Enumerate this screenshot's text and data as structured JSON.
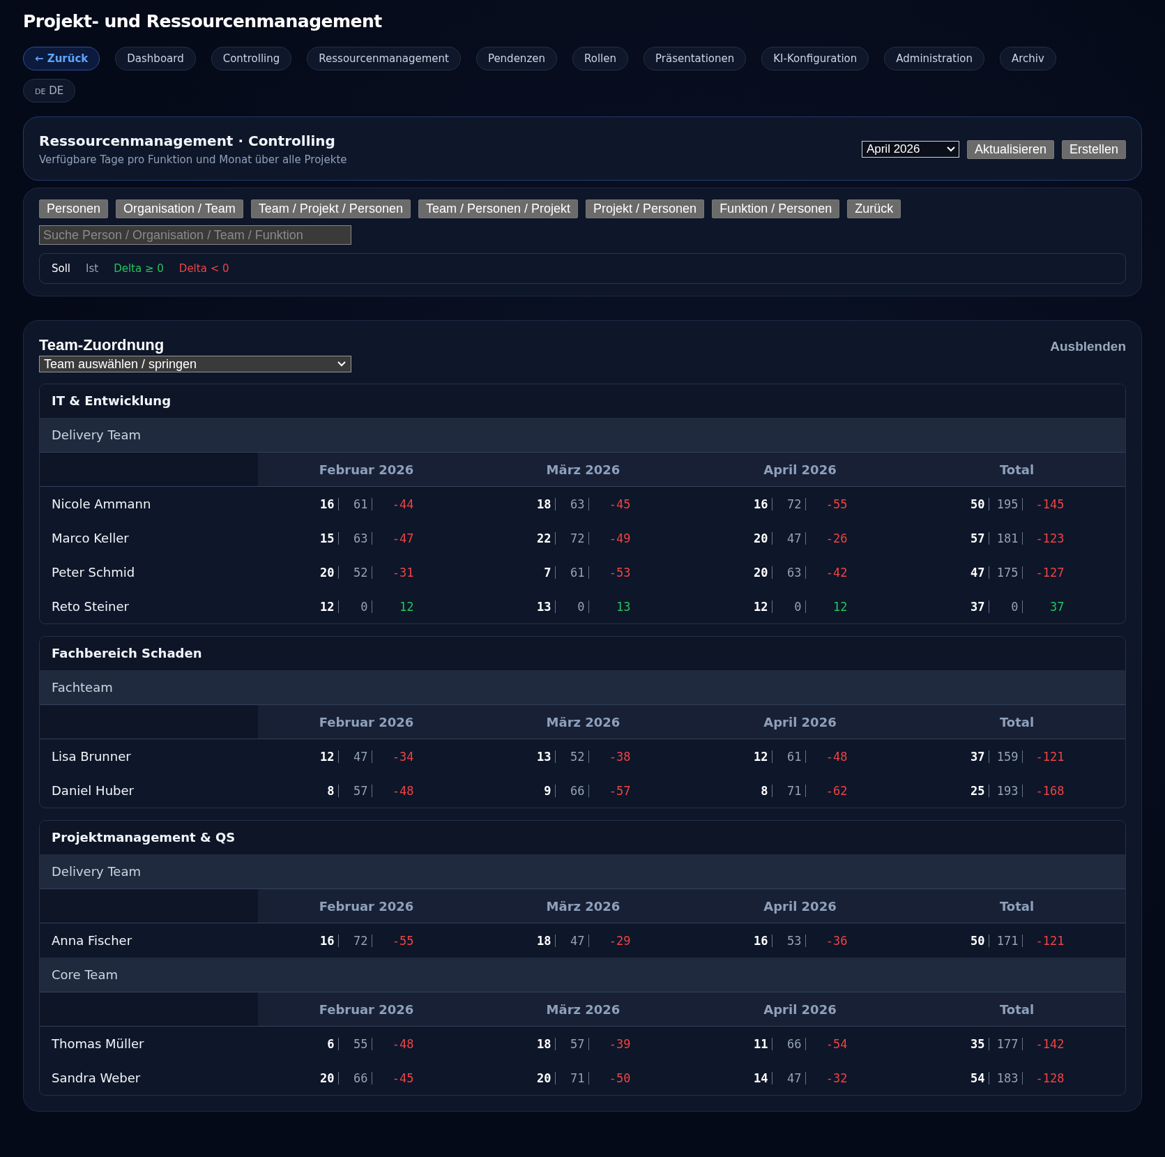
{
  "title": "Projekt- und Ressourcenmanagement",
  "nav": [
    {
      "label": "← Zurück",
      "selected": true
    },
    {
      "label": "Dashboard",
      "selected": false
    },
    {
      "label": "Controlling",
      "selected": false
    },
    {
      "label": "Ressourcenmanagement",
      "selected": false
    },
    {
      "label": "Pendenzen",
      "selected": false
    },
    {
      "label": "Rollen",
      "selected": false
    },
    {
      "label": "Präsentationen",
      "selected": false
    },
    {
      "label": "KI-Konfiguration",
      "selected": false
    },
    {
      "label": "Administration",
      "selected": false
    },
    {
      "label": "Archiv",
      "selected": false
    }
  ],
  "language": {
    "flag": "DE",
    "label": "DE"
  },
  "header": {
    "title": "Ressourcenmanagement · Controlling",
    "subtitle": "Verfügbare Tage pro Funktion und Monat über alle Projekte",
    "month_select": "April 2026",
    "buttons": [
      "Aktualisieren",
      "Erstellen"
    ]
  },
  "views": [
    "Personen",
    "Organisation / Team",
    "Team / Projekt / Personen",
    "Team / Personen / Projekt",
    "Projekt / Personen",
    "Funktion / Personen",
    "Zurück"
  ],
  "search": {
    "placeholder": "Suche Person / Organisation / Team / Funktion"
  },
  "legend": [
    {
      "label": "Soll",
      "kind": "soll"
    },
    {
      "label": "Ist",
      "kind": "ist"
    },
    {
      "label": "Delta ≥ 0",
      "kind": "pos"
    },
    {
      "label": "Delta < 0",
      "kind": "neg"
    }
  ],
  "assignment": {
    "title": "Team-Zuordnung",
    "hide": "Ausblenden",
    "team_select": "Team auswählen / springen",
    "groups": [
      {
        "name": "IT & Entwicklung",
        "teams": [
          {
            "name": "Delivery Team",
            "columns": [
              "Februar 2026",
              "März 2026",
              "April 2026",
              "Total"
            ],
            "rows": [
              {
                "name": "Nicole Ammann",
                "cells": [
                  {
                    "soll": "16",
                    "ist": "61",
                    "delta": "-44",
                    "ok": false
                  },
                  {
                    "soll": "18",
                    "ist": "63",
                    "delta": "-45",
                    "ok": false
                  },
                  {
                    "soll": "16",
                    "ist": "72",
                    "delta": "-55",
                    "ok": false
                  },
                  {
                    "soll": "50",
                    "ist": "195",
                    "delta": "-145",
                    "ok": false
                  }
                ]
              },
              {
                "name": "Marco Keller",
                "cells": [
                  {
                    "soll": "15",
                    "ist": "63",
                    "delta": "-47",
                    "ok": false
                  },
                  {
                    "soll": "22",
                    "ist": "72",
                    "delta": "-49",
                    "ok": false
                  },
                  {
                    "soll": "20",
                    "ist": "47",
                    "delta": "-26",
                    "ok": false
                  },
                  {
                    "soll": "57",
                    "ist": "181",
                    "delta": "-123",
                    "ok": false
                  }
                ]
              },
              {
                "name": "Peter Schmid",
                "cells": [
                  {
                    "soll": "20",
                    "ist": "52",
                    "delta": "-31",
                    "ok": false
                  },
                  {
                    "soll": "7",
                    "ist": "61",
                    "delta": "-53",
                    "ok": false
                  },
                  {
                    "soll": "20",
                    "ist": "63",
                    "delta": "-42",
                    "ok": false
                  },
                  {
                    "soll": "47",
                    "ist": "175",
                    "delta": "-127",
                    "ok": false
                  }
                ]
              },
              {
                "name": "Reto Steiner",
                "cells": [
                  {
                    "soll": "12",
                    "ist": "0",
                    "delta": "12",
                    "ok": true
                  },
                  {
                    "soll": "13",
                    "ist": "0",
                    "delta": "13",
                    "ok": true
                  },
                  {
                    "soll": "12",
                    "ist": "0",
                    "delta": "12",
                    "ok": true
                  },
                  {
                    "soll": "37",
                    "ist": "0",
                    "delta": "37",
                    "ok": true
                  }
                ]
              }
            ]
          }
        ]
      },
      {
        "name": "Fachbereich Schaden",
        "teams": [
          {
            "name": "Fachteam",
            "columns": [
              "Februar 2026",
              "März 2026",
              "April 2026",
              "Total"
            ],
            "rows": [
              {
                "name": "Lisa Brunner",
                "cells": [
                  {
                    "soll": "12",
                    "ist": "47",
                    "delta": "-34",
                    "ok": false
                  },
                  {
                    "soll": "13",
                    "ist": "52",
                    "delta": "-38",
                    "ok": false
                  },
                  {
                    "soll": "12",
                    "ist": "61",
                    "delta": "-48",
                    "ok": false
                  },
                  {
                    "soll": "37",
                    "ist": "159",
                    "delta": "-121",
                    "ok": false
                  }
                ]
              },
              {
                "name": "Daniel Huber",
                "cells": [
                  {
                    "soll": "8",
                    "ist": "57",
                    "delta": "-48",
                    "ok": false
                  },
                  {
                    "soll": "9",
                    "ist": "66",
                    "delta": "-57",
                    "ok": false
                  },
                  {
                    "soll": "8",
                    "ist": "71",
                    "delta": "-62",
                    "ok": false
                  },
                  {
                    "soll": "25",
                    "ist": "193",
                    "delta": "-168",
                    "ok": false
                  }
                ]
              }
            ]
          }
        ]
      },
      {
        "name": "Projektmanagement & QS",
        "teams": [
          {
            "name": "Delivery Team",
            "columns": [
              "Februar 2026",
              "März 2026",
              "April 2026",
              "Total"
            ],
            "rows": [
              {
                "name": "Anna Fischer",
                "cells": [
                  {
                    "soll": "16",
                    "ist": "72",
                    "delta": "-55",
                    "ok": false
                  },
                  {
                    "soll": "18",
                    "ist": "47",
                    "delta": "-29",
                    "ok": false
                  },
                  {
                    "soll": "16",
                    "ist": "53",
                    "delta": "-36",
                    "ok": false
                  },
                  {
                    "soll": "50",
                    "ist": "171",
                    "delta": "-121",
                    "ok": false
                  }
                ]
              }
            ]
          },
          {
            "name": "Core Team",
            "columns": [
              "Februar 2026",
              "März 2026",
              "April 2026",
              "Total"
            ],
            "rows": [
              {
                "name": "Thomas Müller",
                "cells": [
                  {
                    "soll": "6",
                    "ist": "55",
                    "delta": "-48",
                    "ok": false
                  },
                  {
                    "soll": "18",
                    "ist": "57",
                    "delta": "-39",
                    "ok": false
                  },
                  {
                    "soll": "11",
                    "ist": "66",
                    "delta": "-54",
                    "ok": false
                  },
                  {
                    "soll": "35",
                    "ist": "177",
                    "delta": "-142",
                    "ok": false
                  }
                ]
              },
              {
                "name": "Sandra Weber",
                "cells": [
                  {
                    "soll": "20",
                    "ist": "66",
                    "delta": "-45",
                    "ok": false
                  },
                  {
                    "soll": "20",
                    "ist": "71",
                    "delta": "-50",
                    "ok": false
                  },
                  {
                    "soll": "14",
                    "ist": "47",
                    "delta": "-32",
                    "ok": false
                  },
                  {
                    "soll": "54",
                    "ist": "183",
                    "delta": "-128",
                    "ok": false
                  }
                ]
              }
            ]
          }
        ]
      }
    ]
  }
}
